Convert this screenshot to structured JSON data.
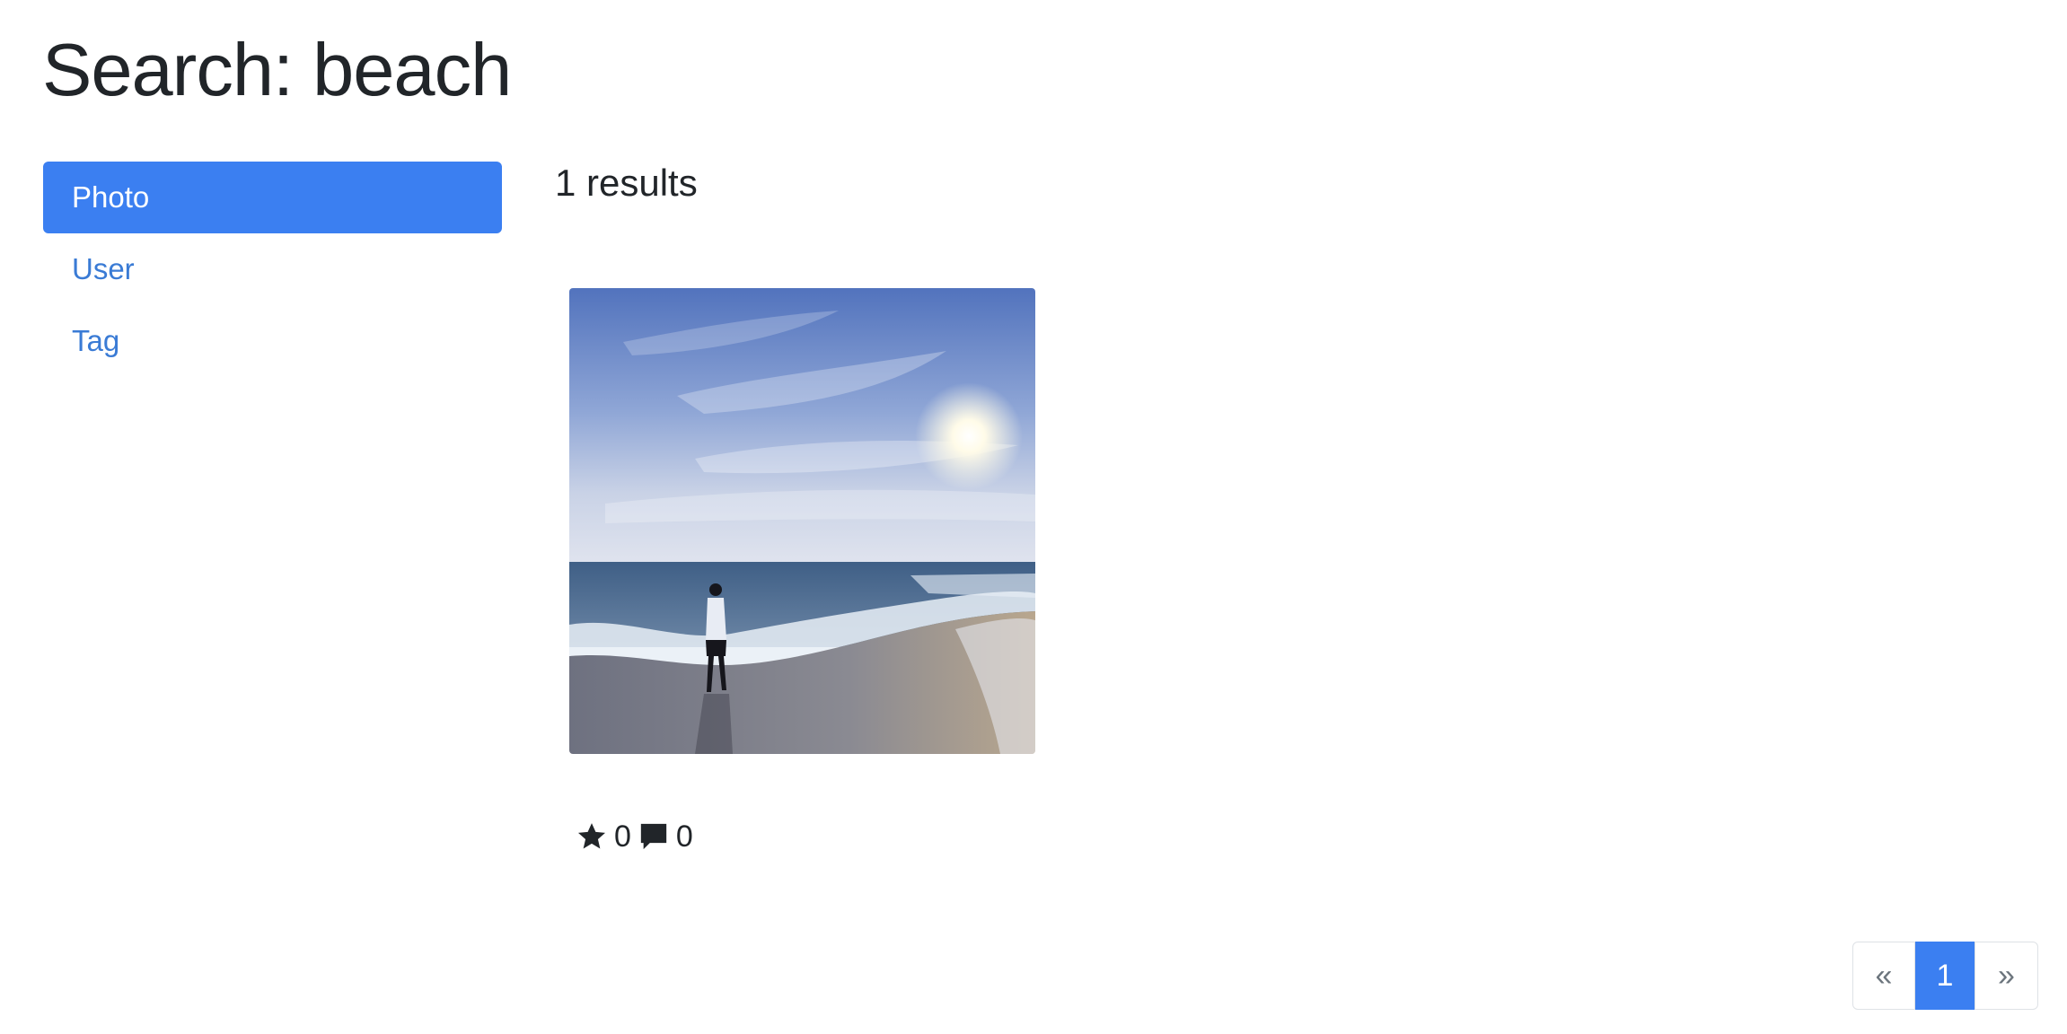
{
  "header": {
    "title": "Search: beach"
  },
  "sidebar": {
    "items": [
      {
        "label": "Photo",
        "active": true
      },
      {
        "label": "User",
        "active": false
      },
      {
        "label": "Tag",
        "active": false
      }
    ]
  },
  "results": {
    "heading": "1 results",
    "items": [
      {
        "image_alt": "person walking on beach at sunset",
        "star_icon": "star-icon",
        "stars": "0",
        "comment_icon": "comment-icon",
        "comments": "0"
      }
    ]
  },
  "pagination": {
    "prev_label": "«",
    "current_page": "1",
    "next_label": "»"
  },
  "colors": {
    "accent": "#3b7ff1",
    "link": "#3a7bd5",
    "text": "#212529"
  }
}
